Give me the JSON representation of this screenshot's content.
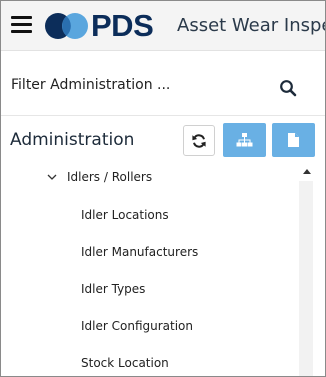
{
  "header": {
    "menu_icon": "hamburger-menu-icon",
    "logo_icon": "pds-logo-icon",
    "logo_text": "PDS",
    "app_title": "Asset Wear Inspect",
    "logo_colors": {
      "dark": "#0c2d5a",
      "light": "#5aa6de"
    }
  },
  "filter": {
    "value": "Filter Administration  ...",
    "search_icon": "search-icon"
  },
  "admin": {
    "title": "Administration",
    "refresh_icon": "refresh-icon",
    "hierarchy_icon": "hierarchy-icon",
    "document_icon": "document-icon",
    "accent": "#69b0e4"
  },
  "tree": {
    "group": {
      "label": "Idlers / Rollers",
      "expanded": true,
      "chevron_icon": "chevron-down-icon"
    },
    "items": [
      {
        "label": "Idler Locations"
      },
      {
        "label": "Idler Manufacturers"
      },
      {
        "label": "Idler Types"
      },
      {
        "label": "Idler Configuration"
      },
      {
        "label": "Stock Location"
      }
    ]
  },
  "scrollbar": {
    "up_icon": "scroll-up-arrow-icon"
  }
}
